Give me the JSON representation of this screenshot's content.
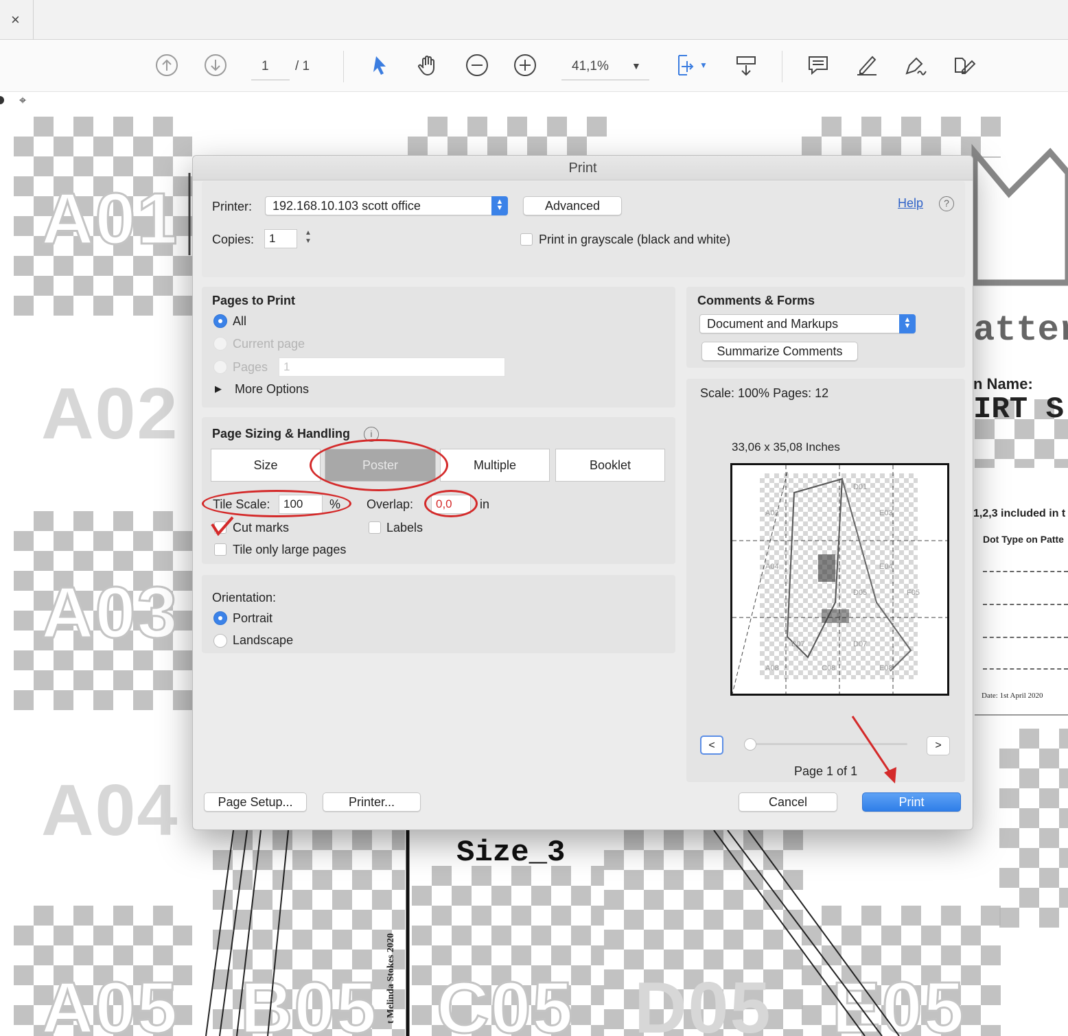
{
  "app": {
    "tab_close_glyph": "×",
    "toolbar": {
      "page_current": "1",
      "page_total": "/ 1",
      "zoom": "41,1%",
      "icons": [
        "prev-page-icon",
        "next-page-icon",
        "select-arrow-icon",
        "hand-icon",
        "zoom-out-icon",
        "zoom-in-icon",
        "zoom-dropdown-icon",
        "fit-page-icon",
        "scroll-mode-icon",
        "comment-icon",
        "highlight-icon",
        "sign-icon",
        "send-icon"
      ]
    }
  },
  "background": {
    "tile_labels": [
      "A01",
      "A02",
      "A03",
      "A04",
      "A05",
      "B05",
      "C05",
      "D05",
      "E05"
    ],
    "size_label": "Size_3",
    "side_text": {
      "name_label": "n Name:",
      "big_text": "IRT S",
      "included": "1,2,3 included in t",
      "dot_type": "Dot Type on Patte",
      "date": "Date: 1st April 2020",
      "pattern_word": "atter"
    },
    "vertical_credit": "t Melinda Stokes 2020"
  },
  "dialog": {
    "title": "Print",
    "printer_label": "Printer:",
    "printer_value": "192.168.10.103 scott office",
    "advanced_button": "Advanced",
    "help_link": "Help",
    "copies_label": "Copies:",
    "copies_value": "1",
    "grayscale_label": "Print in grayscale (black and white)",
    "pages_to_print": {
      "heading": "Pages to Print",
      "all": "All",
      "current_page": "Current page",
      "pages": "Pages",
      "pages_value": "1",
      "more_options": "More Options"
    },
    "comments_forms": {
      "heading": "Comments & Forms",
      "value": "Document and Markups",
      "summarize_button": "Summarize Comments"
    },
    "sizing": {
      "heading": "Page Sizing & Handling",
      "tabs": [
        "Size",
        "Poster",
        "Multiple",
        "Booklet"
      ],
      "active_tab": "Poster",
      "tile_scale_label": "Tile Scale:",
      "tile_scale_value": "100",
      "percent": "%",
      "overlap_label": "Overlap:",
      "overlap_value": "0,0",
      "overlap_unit": "in",
      "cut_marks": "Cut marks",
      "labels": "Labels",
      "tile_only_large": "Tile only large pages"
    },
    "orientation": {
      "heading": "Orientation:",
      "portrait": "Portrait",
      "landscape": "Landscape"
    },
    "preview": {
      "scale_info": "Scale: 100% Pages: 12",
      "dimensions": "33,06 x 35,08 Inches",
      "page_info": "Page 1 of 1",
      "prev": "<",
      "next": ">",
      "mini_labels": [
        "A02",
        "D01",
        "E03",
        "A04",
        "E04",
        "D05",
        "F05",
        "B07",
        "D07",
        "A08",
        "C08",
        "E08"
      ]
    },
    "buttons": {
      "page_setup": "Page Setup...",
      "printer": "Printer...",
      "cancel": "Cancel",
      "print": "Print"
    }
  },
  "colors": {
    "accent": "#3b82e8",
    "annotation_red": "#d42a2a",
    "dialog_bg": "#ececec"
  }
}
